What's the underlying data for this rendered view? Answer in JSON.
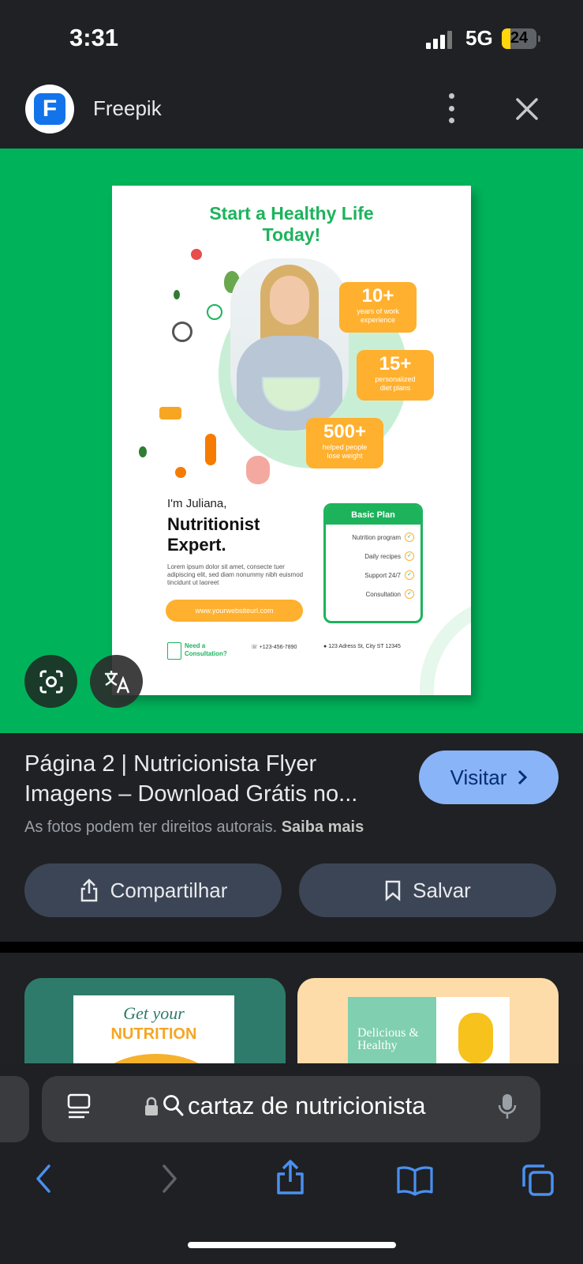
{
  "status": {
    "time": "3:31",
    "network": "5G",
    "battery": "24",
    "battery_level": 0.24
  },
  "header": {
    "app_logo_letter": "F",
    "title": "Freepik"
  },
  "flyer": {
    "headline": "Start a Healthy Life Today!",
    "stats": [
      {
        "number": "10+",
        "text": "years of work experience"
      },
      {
        "number": "15+",
        "text": "personalized diet plans"
      },
      {
        "number": "500+",
        "text": "helped people lose weight"
      }
    ],
    "greeting": "I'm Juliana,",
    "role": "Nutritionist Expert.",
    "lorem": "Lorem ipsum dolor sit amet, consecte tuer adipiscing elit, sed diam nonummy nibh euismod tincidunt ut laoreet",
    "website": "www.yourwebsiteurl.com",
    "plan_title": "Basic Plan",
    "plan_items": [
      "Nutrition program",
      "Daily recipes",
      "Support 24/7",
      "Consultation"
    ],
    "consult": "Need a Consultation?",
    "phone": "+123-456-7890",
    "address": "123 Adress St, City ST 12345"
  },
  "result": {
    "title": "Página 2 | Nutricionista Flyer Imagens – Download Grátis no...",
    "copyright": "As fotos podem ter direitos autorais.",
    "learn_more": "Saiba mais",
    "visit_label": "Visitar",
    "share_label": "Compartilhar",
    "save_label": "Salvar"
  },
  "thumbs": {
    "t1_line1": "Get your",
    "t1_line2": "NUTRITION",
    "t2_text": "Delicious & Healthy"
  },
  "browser": {
    "url_text": "cartaz de nutricionista"
  },
  "colors": {
    "accent_green": "#00b35a",
    "visit_blue": "#8ab4f8",
    "orange": "#ffb02e"
  }
}
